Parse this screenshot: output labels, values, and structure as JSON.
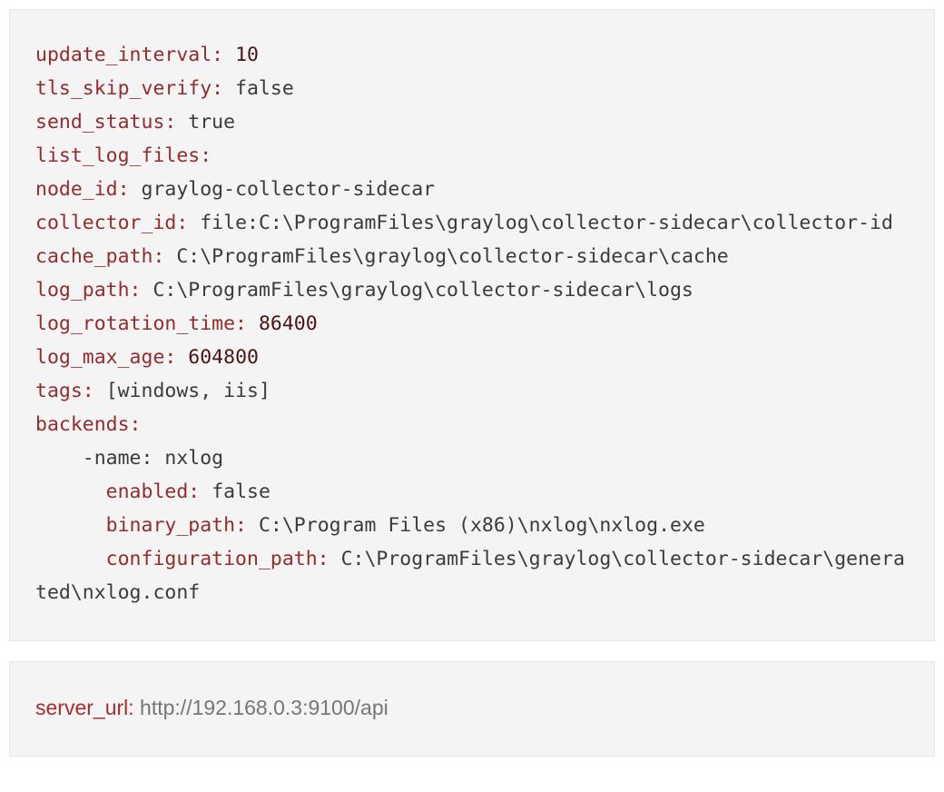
{
  "config": {
    "update_interval": {
      "key": "update_interval:",
      "value": "10"
    },
    "tls_skip_verify": {
      "key": "tls_skip_verify:",
      "value": "false"
    },
    "send_status": {
      "key": "send_status:",
      "value": "true"
    },
    "list_log_files": {
      "key": "list_log_files:"
    },
    "node_id": {
      "key": "node_id:",
      "value": "graylog-collector-sidecar"
    },
    "collector_id": {
      "key": "collector_id:",
      "value": "file:C:\\ProgramFiles\\graylog\\collector-sidecar\\collector-id"
    },
    "cache_path": {
      "key": "cache_path:",
      "value": "C:\\ProgramFiles\\graylog\\collector-sidecar\\cache"
    },
    "log_path": {
      "key": "log_path:",
      "value": "C:\\ProgramFiles\\graylog\\collector-sidecar\\logs"
    },
    "log_rotation_time": {
      "key": "log_rotation_time:",
      "value": "86400"
    },
    "log_max_age": {
      "key": "log_max_age:",
      "value": "604800"
    },
    "tags": {
      "key": "tags:",
      "value": "[windows, iis]"
    },
    "backends_key": "backends:",
    "backend_name": {
      "prefix": "    -name: ",
      "value": "nxlog"
    },
    "backend_enabled": {
      "key": "enabled:",
      "value": "false"
    },
    "backend_binary_path": {
      "key": "binary_path:",
      "value": "C:\\Program Files (x86)\\nxlog\\nxlog.exe"
    },
    "backend_configuration_path": {
      "key": "configuration_path:",
      "value": "C:\\ProgramFiles\\graylog\\collector-sidecar\\generated\\nxlog.conf"
    },
    "indent": "      "
  },
  "server": {
    "key": "server_url:",
    "value": "http://192.168.0.3:9100/api"
  }
}
